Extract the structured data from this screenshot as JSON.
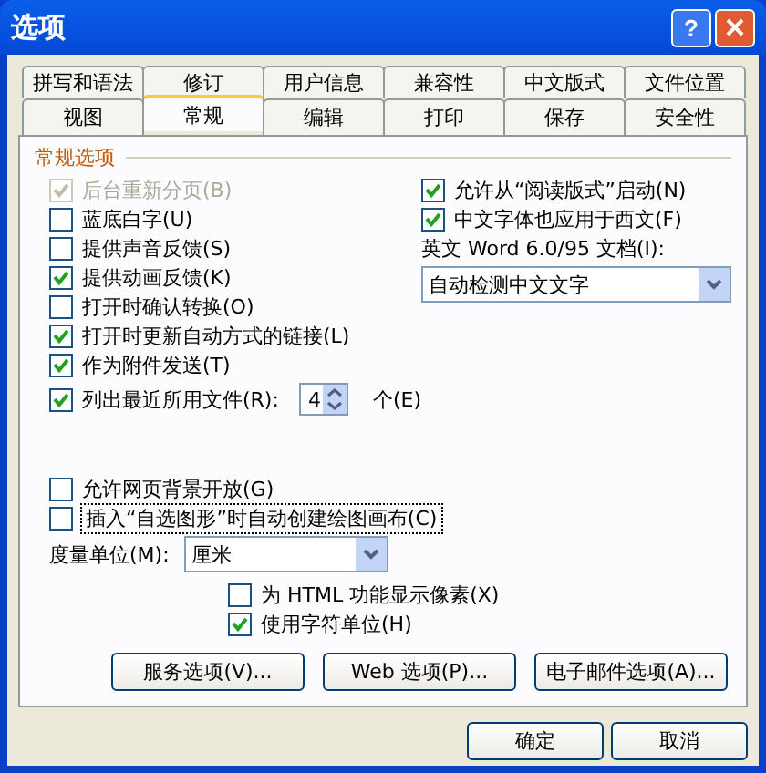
{
  "window": {
    "title": "选项",
    "help_label": "?"
  },
  "tab_rows": [
    [
      {
        "label": "拼写和语法",
        "selected": false
      },
      {
        "label": "修订",
        "selected": false
      },
      {
        "label": "用户信息",
        "selected": false
      },
      {
        "label": "兼容性",
        "selected": false
      },
      {
        "label": "中文版式",
        "selected": false
      },
      {
        "label": "文件位置",
        "selected": false
      }
    ],
    [
      {
        "label": "视图",
        "selected": false
      },
      {
        "label": "常规",
        "selected": true
      },
      {
        "label": "编辑",
        "selected": false
      },
      {
        "label": "打印",
        "selected": false
      },
      {
        "label": "保存",
        "selected": false
      },
      {
        "label": "安全性",
        "selected": false
      }
    ]
  ],
  "group_title": "常规选项",
  "left_options": [
    {
      "label": "后台重新分页(B)",
      "checked": true,
      "disabled": true
    },
    {
      "label": "蓝底白字(U)",
      "checked": false,
      "disabled": false
    },
    {
      "label": "提供声音反馈(S)",
      "checked": false,
      "disabled": false
    },
    {
      "label": "提供动画反馈(K)",
      "checked": true,
      "disabled": false
    },
    {
      "label": "打开时确认转换(O)",
      "checked": false,
      "disabled": false
    },
    {
      "label": "打开时更新自动方式的链接(L)",
      "checked": true,
      "disabled": false
    },
    {
      "label": "作为附件发送(T)",
      "checked": true,
      "disabled": false
    }
  ],
  "recent_files": {
    "label": "列出最近所用文件(R):",
    "checked": true,
    "value": "4",
    "unit": "个(E)"
  },
  "right_options": [
    {
      "label": "允许从“阅读版式”启动(N)",
      "checked": true,
      "disabled": false
    },
    {
      "label": "中文字体也应用于西文(F)",
      "checked": true,
      "disabled": false
    }
  ],
  "word6_label": "英文 Word 6.0/95 文档(I):",
  "word6_value": "自动检测中文文字",
  "lower_options": [
    {
      "label": "允许网页背景开放(G)",
      "checked": false,
      "focused": false
    },
    {
      "label": "插入“自选图形”时自动创建绘图画布(C)",
      "checked": false,
      "focused": true
    }
  ],
  "units_label": "度量单位(M):",
  "units_value": "厘米",
  "unit_options": [
    {
      "label": "为 HTML 功能显示像素(X)",
      "checked": false
    },
    {
      "label": "使用字符单位(H)",
      "checked": true
    }
  ],
  "option_buttons": [
    "服务选项(V)...",
    "Web 选项(P)...",
    "电子邮件选项(A)..."
  ],
  "dialog_buttons": [
    "确定",
    "取消"
  ]
}
